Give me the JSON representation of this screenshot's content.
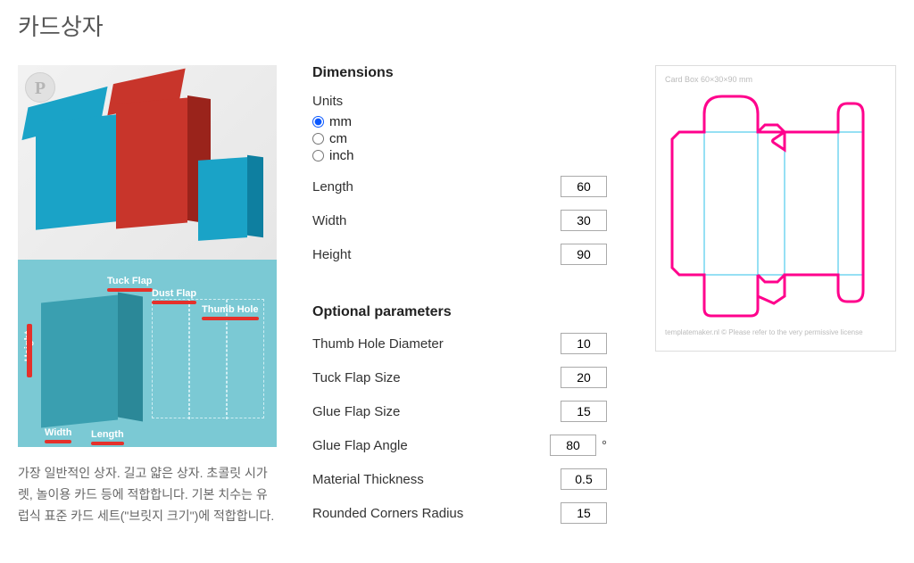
{
  "title": "카드상자",
  "photo_overlay": {
    "pinterest_badge": "P"
  },
  "diagram_labels": {
    "tuck_flap": "Tuck Flap",
    "dust_flap": "Dust Flap",
    "thumb_hole": "Thumb Hole",
    "height": "Height",
    "width": "Width",
    "length": "Length"
  },
  "description": "가장 일반적인 상자. 길고 얇은 상자. 초콜릿 시가렛, 놀이용 카드 등에 적합합니다. 기본 치수는 유럽식 표준 카드 세트(\"브릿지 크기\")에 적합합니다.",
  "dimensions": {
    "heading": "Dimensions",
    "units_label": "Units",
    "units": {
      "mm": "mm",
      "cm": "cm",
      "inch": "inch",
      "selected": "mm"
    },
    "length_label": "Length",
    "length_value": "60",
    "width_label": "Width",
    "width_value": "30",
    "height_label": "Height",
    "height_value": "90"
  },
  "optional": {
    "heading": "Optional parameters",
    "thumb_label": "Thumb Hole Diameter",
    "thumb_value": "10",
    "tuck_label": "Tuck Flap Size",
    "tuck_value": "20",
    "glue_size_label": "Glue Flap Size",
    "glue_size_value": "15",
    "glue_angle_label": "Glue Flap Angle",
    "glue_angle_value": "80",
    "glue_angle_suffix": "°",
    "thickness_label": "Material Thickness",
    "thickness_value": "0.5",
    "radius_label": "Rounded Corners Radius",
    "radius_value": "15"
  },
  "preview": {
    "caption_top": "Card Box 60×30×90 mm",
    "caption_bottom": "templatemaker.nl © Please refer to the very permissive license"
  }
}
